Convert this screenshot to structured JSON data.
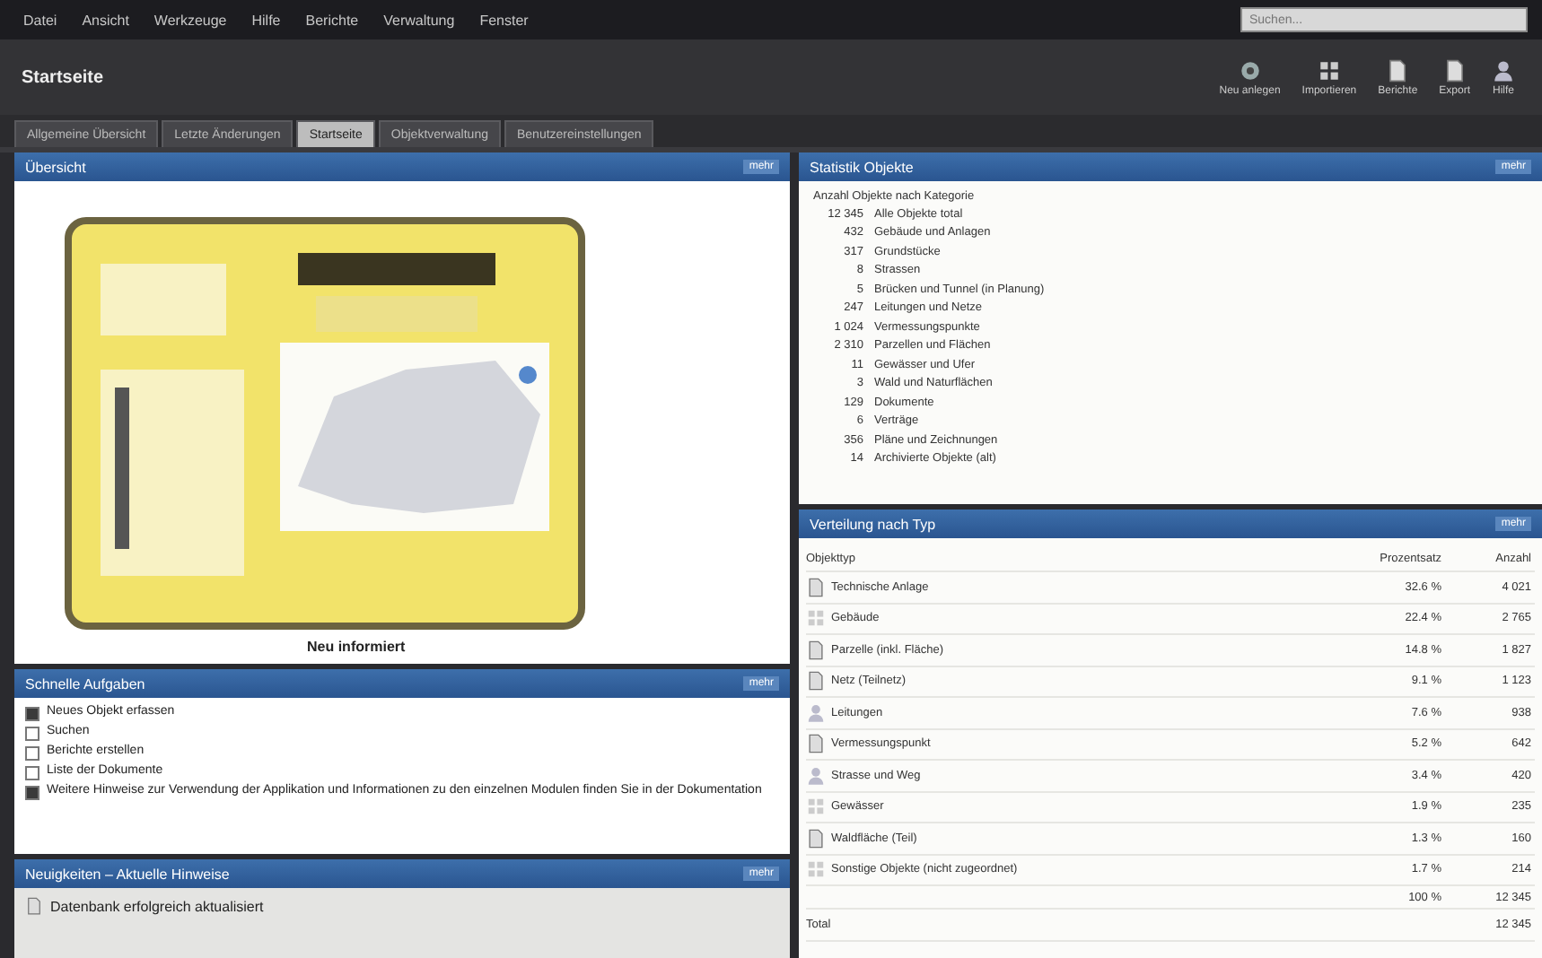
{
  "menu": [
    "Datei",
    "Ansicht",
    "Werkzeuge",
    "Hilfe",
    "Berichte",
    "Verwaltung",
    "Fenster"
  ],
  "search": {
    "placeholder": "Suchen..."
  },
  "title": "Startseite",
  "toolbar": [
    {
      "label": "Neu anlegen",
      "kind": "gear"
    },
    {
      "label": "Importieren",
      "kind": "grid"
    },
    {
      "label": "Berichte",
      "kind": "doc"
    },
    {
      "label": "Export",
      "kind": "doc"
    },
    {
      "label": "Hilfe",
      "kind": "user"
    }
  ],
  "tabs": [
    {
      "label": "Allgemeine Übersicht",
      "selected": false
    },
    {
      "label": "Letzte Änderungen",
      "selected": false
    },
    {
      "label": "Startseite",
      "selected": true
    },
    {
      "label": "Objektverwaltung",
      "selected": false
    },
    {
      "label": "Benutzereinstellungen",
      "selected": false
    }
  ],
  "overview": {
    "title": "Übersicht",
    "action": "mehr",
    "caption": "Neu informiert"
  },
  "tasks": {
    "title": "Schnelle Aufgaben",
    "action": "mehr",
    "items": [
      {
        "text": "Neues Objekt erfassen",
        "checked": true
      },
      {
        "text": "Suchen",
        "checked": false
      },
      {
        "text": "Berichte erstellen",
        "checked": false
      },
      {
        "text": "Liste der Dokumente",
        "checked": false
      },
      {
        "text": "Weitere Hinweise zur Verwendung der Applikation und Informationen zu den einzelnen Modulen finden Sie in der Dokumentation",
        "checked": true
      }
    ]
  },
  "news": {
    "title": "Neuigkeiten – Aktuelle Hinweise",
    "action": "mehr",
    "items": [
      "Datenbank erfolgreich aktualisiert"
    ]
  },
  "stats": {
    "title": "Statistik Objekte",
    "action": "mehr",
    "heading": "Anzahl Objekte nach Kategorie",
    "rows": [
      {
        "count": "12 345",
        "label": "Alle Objekte total"
      },
      {
        "count": "432",
        "label": "Gebäude und Anlagen"
      },
      {
        "count": "317",
        "label": "Grundstücke"
      },
      {
        "count": "8",
        "label": "Strassen"
      },
      {
        "count": "5",
        "label": "Brücken und Tunnel (in Planung)"
      },
      {
        "count": "247",
        "label": "Leitungen und Netze"
      },
      {
        "count": "1 024",
        "label": "Vermessungspunkte"
      },
      {
        "count": "2 310",
        "label": "Parzellen und Flächen"
      },
      {
        "count": "11",
        "label": "Gewässer und Ufer"
      },
      {
        "count": "3",
        "label": "Wald und Naturflächen"
      },
      {
        "count": "129",
        "label": "Dokumente"
      },
      {
        "count": "6",
        "label": "Verträge"
      },
      {
        "count": "356",
        "label": "Pläne und Zeichnungen"
      },
      {
        "count": "14",
        "label": "Archivierte Objekte (alt)"
      }
    ]
  },
  "types": {
    "title": "Verteilung nach Typ",
    "action": "mehr",
    "columns": [
      "Objekttyp",
      "Prozentsatz",
      "Anzahl"
    ],
    "rows": [
      {
        "kind": "doc",
        "name": "Technische Anlage",
        "pct": "32.6 %",
        "n": "4 021"
      },
      {
        "kind": "grid",
        "name": "Gebäude",
        "pct": "22.4 %",
        "n": "2 765"
      },
      {
        "kind": "doc",
        "name": "Parzelle (inkl. Fläche)",
        "pct": "14.8 %",
        "n": "1 827"
      },
      {
        "kind": "doc",
        "name": "Netz (Teilnetz)",
        "pct": "9.1 %",
        "n": "1 123"
      },
      {
        "kind": "user",
        "name": "Leitungen",
        "pct": "7.6 %",
        "n": "938"
      },
      {
        "kind": "doc",
        "name": "Vermessungspunkt",
        "pct": "5.2 %",
        "n": "642"
      },
      {
        "kind": "user",
        "name": "Strasse und Weg",
        "pct": "3.4 %",
        "n": "420"
      },
      {
        "kind": "grid",
        "name": "Gewässer",
        "pct": "1.9 %",
        "n": "235"
      },
      {
        "kind": "doc",
        "name": "Waldfläche (Teil)",
        "pct": "1.3 %",
        "n": "160"
      },
      {
        "kind": "grid",
        "name": "Sonstige Objekte (nicht zugeordnet)",
        "pct": "1.7 %",
        "n": "214"
      }
    ],
    "subtotal": {
      "pct": "100 %",
      "n": "12 345"
    },
    "total": {
      "label": "Total",
      "n": "12 345"
    }
  }
}
